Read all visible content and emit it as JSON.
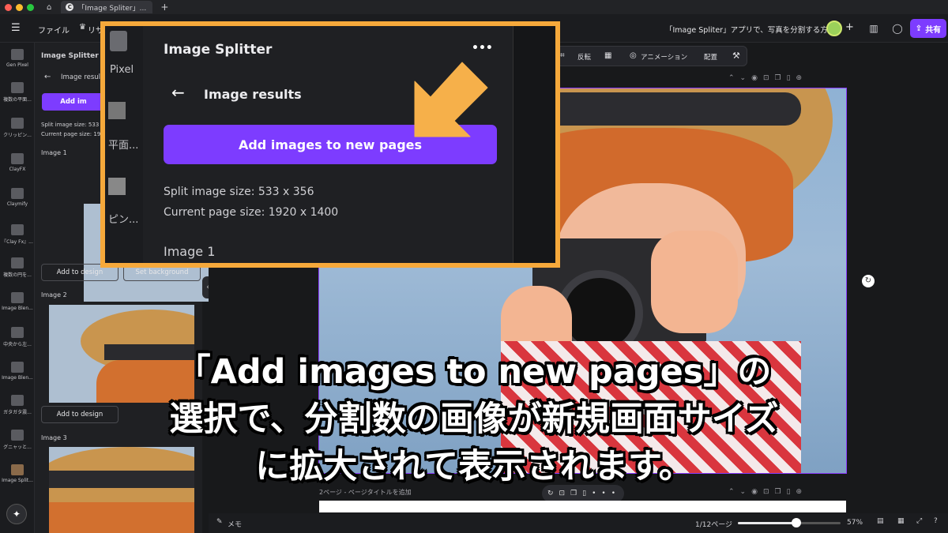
{
  "tabbar": {
    "tab_title": "「Image Spliter」...",
    "new_tab": "+"
  },
  "header": {
    "file_menu": "ファイル",
    "resize_menu": "リサ",
    "doc_title": "「Image Spliter」アプリで、写真を分割する方法",
    "share_label": "共有",
    "add": "+"
  },
  "rail": {
    "items": [
      {
        "label": "Gen Pixel"
      },
      {
        "label": "複数の平面..."
      },
      {
        "label": "クリッピン..."
      },
      {
        "label": "ClayFX"
      },
      {
        "label": "Claymify"
      },
      {
        "label": "『Clay Fx』..."
      },
      {
        "label": "複数の円を..."
      },
      {
        "label": "Image Blen..."
      },
      {
        "label": "中央から左..."
      },
      {
        "label": "Image Blen..."
      },
      {
        "label": "ガタガタ震..."
      },
      {
        "label": "グニャッと..."
      },
      {
        "label": "Image Split..."
      }
    ]
  },
  "panel": {
    "app_title": "Image Splitter",
    "back_label": "Image results",
    "add_button_partial": "Add im",
    "split_size": "Split image size: 533 x",
    "page_size": "Current page size: 19",
    "image1": "Image 1",
    "image2": "Image 2",
    "image3": "Image 3",
    "add_to_design": "Add to design",
    "set_background": "Set background"
  },
  "toolbar": {
    "flip": "反転",
    "animation": "アニメーション",
    "arrange": "配置"
  },
  "callout": {
    "rail_label1": "Pixel",
    "rail_label2": "平面...",
    "rail_label3": "ピン...",
    "app_title": "Image Splitter",
    "more": "•••",
    "back_label": "Image results",
    "add_button": "Add images to new pages",
    "split_size": "Split image size: 533 x 356",
    "page_size": "Current page size: 1920 x 1400",
    "image1": "Image 1"
  },
  "canvas": {
    "page_label": "2ページ - ページタイトルを追加"
  },
  "bottom": {
    "notes": "メモ",
    "page_counter": "1/12ページ",
    "zoom": "57%",
    "zoom_level": 0.57
  },
  "caption": {
    "line1": "「Add images to new pages」の",
    "line2": "選択で、分割数の画像が新規画面サイズ",
    "line3": "に拡大されて表示されます。"
  },
  "colors": {
    "accent": "#7d3cff",
    "callout_border": "#f6a93b",
    "arrow": "#f6b04a"
  }
}
